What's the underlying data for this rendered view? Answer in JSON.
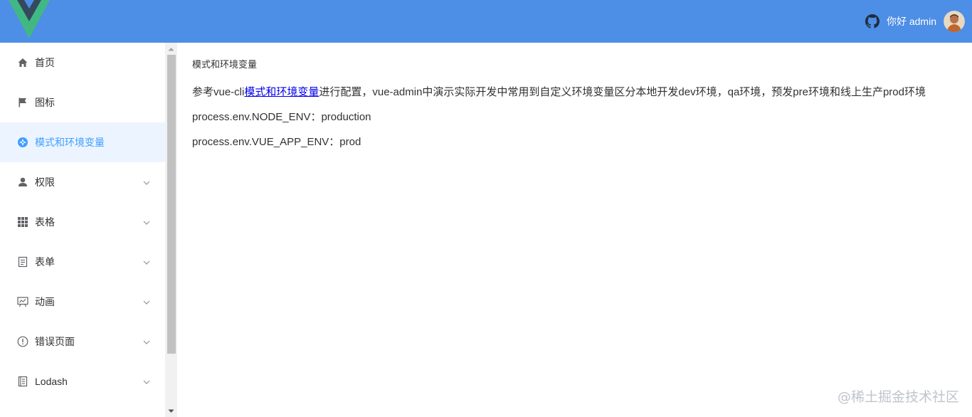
{
  "header": {
    "greeting": "你好 admin",
    "brand_color": "#4d8ee6"
  },
  "sidebar": {
    "items": [
      {
        "label": "首页",
        "icon": "home-icon",
        "has_children": false,
        "active": false
      },
      {
        "label": "图标",
        "icon": "flag-icon",
        "has_children": false,
        "active": false
      },
      {
        "label": "模式和环境变量",
        "icon": "compass-icon",
        "has_children": false,
        "active": true
      },
      {
        "label": "权限",
        "icon": "user-icon",
        "has_children": true,
        "active": false
      },
      {
        "label": "表格",
        "icon": "grid-icon",
        "has_children": true,
        "active": false
      },
      {
        "label": "表单",
        "icon": "document-icon",
        "has_children": true,
        "active": false
      },
      {
        "label": "动画",
        "icon": "presentation-icon",
        "has_children": true,
        "active": false
      },
      {
        "label": "错误页面",
        "icon": "warning-icon",
        "has_children": true,
        "active": false
      },
      {
        "label": "Lodash",
        "icon": "notebook-icon",
        "has_children": true,
        "active": false
      }
    ],
    "active_color": "#409eff",
    "active_bg": "#ecf5ff"
  },
  "main": {
    "title": "模式和环境变量",
    "desc_prefix": "参考vue-cli",
    "desc_link": "模式和环境变量",
    "desc_suffix": "进行配置，vue-admin中演示实际开发中常用到自定义环境变量区分本地开发dev环境，qa环境，预发pre环境和线上生产prod环境",
    "node_env_line": "process.env.NODE_ENV：production",
    "app_env_line": "process.env.VUE_APP_ENV：prod"
  },
  "watermark": "@稀土掘金技术社区"
}
